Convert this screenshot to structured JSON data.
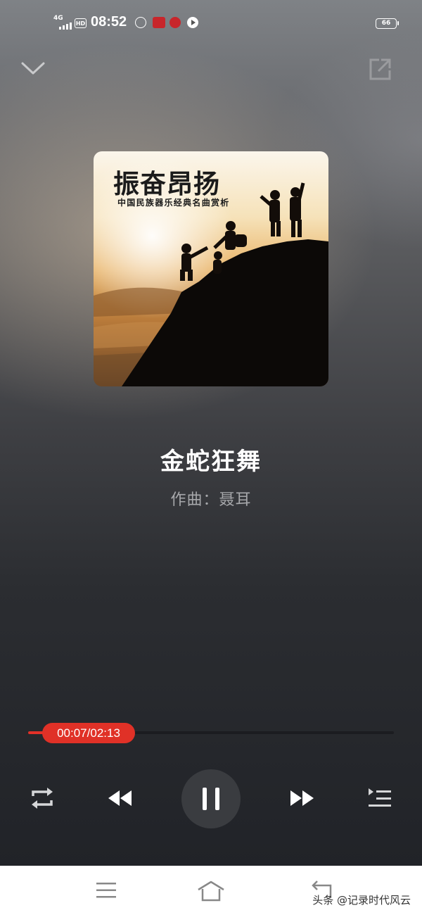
{
  "status_bar": {
    "network": "4G",
    "hd": "HD",
    "time": "08:52",
    "battery": "66"
  },
  "player": {
    "album_title": "振奋昂扬",
    "album_subtitle": "中国民族器乐经典名曲赏析",
    "song_title": "金蛇狂舞",
    "song_subtitle": "作曲：聂耳",
    "time_display": "00:07/02:13",
    "progress": 0.053
  },
  "colors": {
    "accent": "#e03127",
    "background_dark": "#212328",
    "navbar": "#ffffff"
  },
  "icons": {
    "collapse": "chevron-down-icon",
    "share": "share-external-icon",
    "repeat": "repeat-icon",
    "previous": "previous-icon",
    "pause": "pause-icon",
    "next": "next-icon",
    "playlist": "playlist-icon",
    "nav_menu": "menu-icon",
    "nav_home": "home-icon",
    "nav_back": "back-icon"
  },
  "watermark": "头条 @记录时代风云"
}
